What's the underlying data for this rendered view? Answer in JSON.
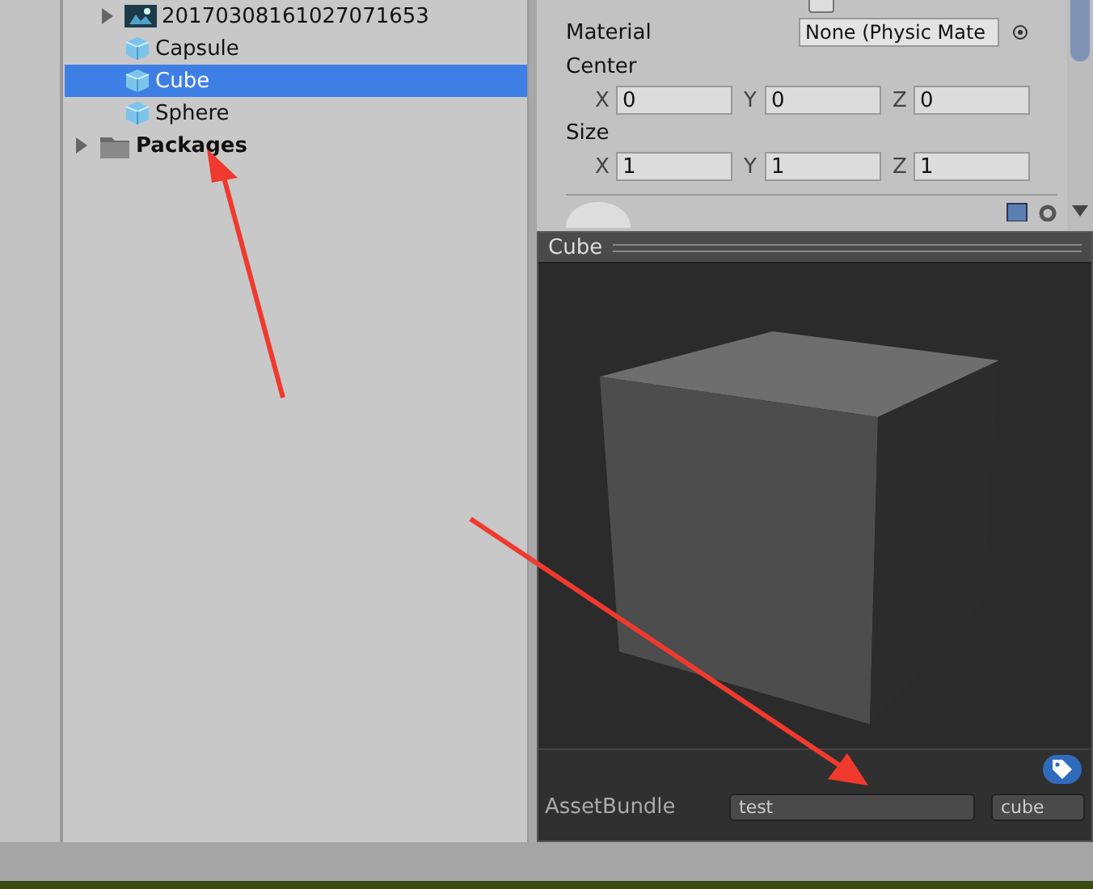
{
  "hierarchy": {
    "items": [
      {
        "label": "20170308161027071653",
        "kind": "image",
        "expanded": false,
        "selected": false
      },
      {
        "label": "Capsule",
        "kind": "prefab",
        "selected": false
      },
      {
        "label": "Cube",
        "kind": "prefab",
        "selected": true
      },
      {
        "label": "Sphere",
        "kind": "prefab",
        "selected": false
      }
    ],
    "packages": {
      "label": "Packages",
      "expanded": false
    }
  },
  "inspector": {
    "trigger_checked": false,
    "material": {
      "label": "Material",
      "value": "None (Physic Mate"
    },
    "vectors": [
      {
        "label": "Center",
        "fields": [
          {
            "axis": "X",
            "value": "0"
          },
          {
            "axis": "Y",
            "value": "0"
          },
          {
            "axis": "Z",
            "value": "0"
          }
        ]
      },
      {
        "label": "Size",
        "fields": [
          {
            "axis": "X",
            "value": "1"
          },
          {
            "axis": "Y",
            "value": "1"
          },
          {
            "axis": "Z",
            "value": "1"
          }
        ]
      }
    ]
  },
  "preview": {
    "title": "Cube",
    "asset_bundle": {
      "label": "AssetBundle",
      "name": "test",
      "variant": "cube"
    }
  }
}
